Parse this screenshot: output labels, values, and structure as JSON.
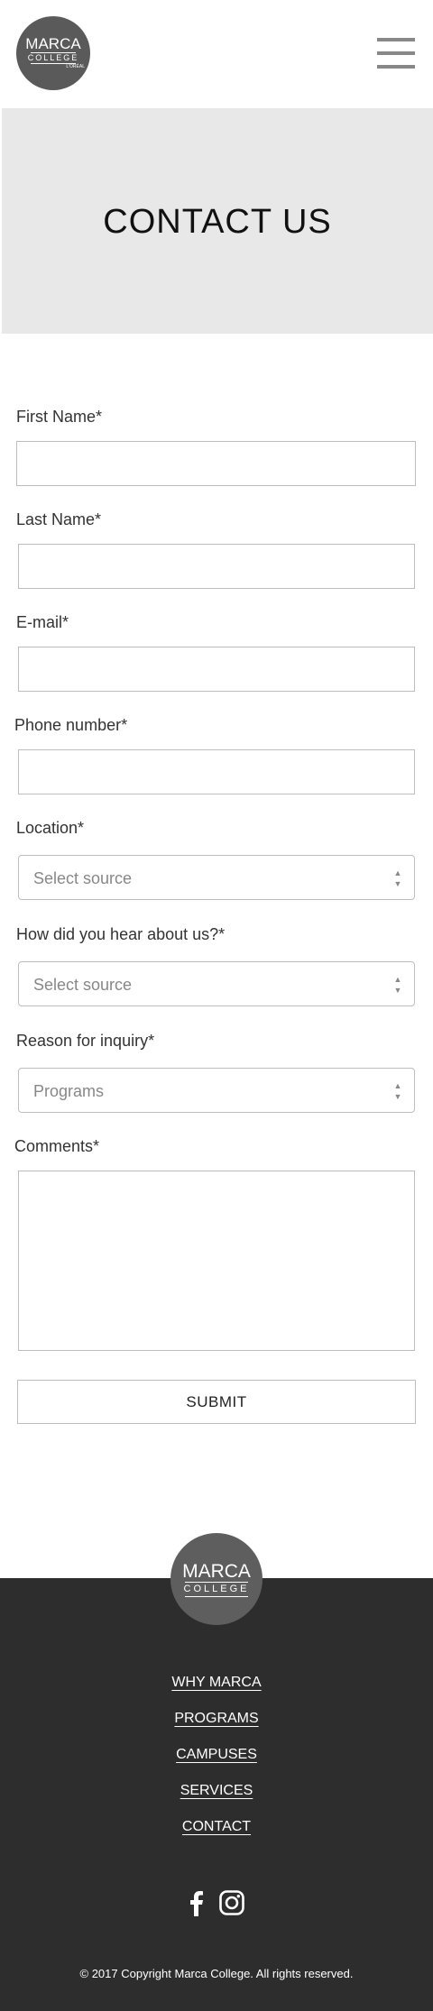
{
  "header": {
    "logo": {
      "line1": "MARCA",
      "line2": "COLLEGE",
      "line3": "L'ORÉAL"
    },
    "menu_icon": "hamburger-menu-icon"
  },
  "hero": {
    "title": "CONTACT US"
  },
  "form": {
    "first_name": {
      "label": "First Name*",
      "value": ""
    },
    "last_name": {
      "label": "Last Name*",
      "value": ""
    },
    "email": {
      "label": "E-mail*",
      "value": ""
    },
    "phone": {
      "label": "Phone number*",
      "value": ""
    },
    "location": {
      "label": "Location*",
      "selected": "Select source"
    },
    "hear_about": {
      "label": "How did you hear about us?*",
      "selected": "Select source"
    },
    "reason": {
      "label": "Reason for inquiry*",
      "selected": "Programs"
    },
    "comments": {
      "label": "Comments*",
      "value": ""
    },
    "submit_label": "SUBMIT"
  },
  "footer": {
    "logo": {
      "line1": "MARCA",
      "line2": "COLLEGE"
    },
    "links": [
      "WHY MARCA",
      "PROGRAMS",
      "CAMPUSES",
      "SERVICES",
      "CONTACT"
    ],
    "social": [
      "facebook-icon",
      "instagram-icon"
    ],
    "copyright": "© 2017 Copyright Marca College. All rights reserved."
  },
  "colors": {
    "hero_bg": "#e8e8e8",
    "footer_bg": "#2d2d2d",
    "logo_bg": "#5a5a5a",
    "border": "#bdbdbd"
  }
}
